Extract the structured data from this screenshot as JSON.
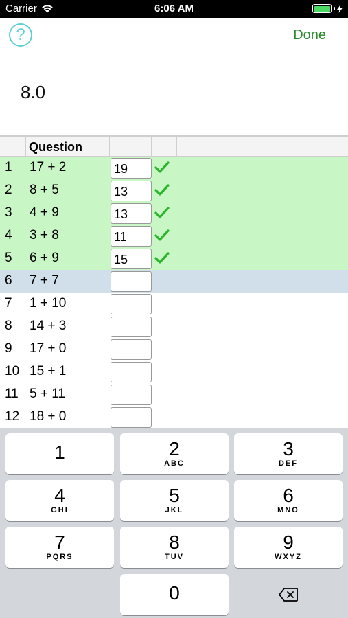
{
  "status_bar": {
    "carrier": "Carrier",
    "time": "6:06 AM"
  },
  "nav": {
    "help_icon": "question-circle-icon",
    "help_label": "?",
    "done_label": "Done"
  },
  "display": {
    "score": "8.0"
  },
  "table": {
    "headers": [
      "",
      "Question",
      "",
      "",
      "",
      ""
    ],
    "rows": [
      {
        "num": "1",
        "question": "17 + 2",
        "answer": "19",
        "status": "correct"
      },
      {
        "num": "2",
        "question": "8 + 5",
        "answer": "13",
        "status": "correct"
      },
      {
        "num": "3",
        "question": "4 + 9",
        "answer": "13",
        "status": "correct"
      },
      {
        "num": "4",
        "question": "3 + 8",
        "answer": "11",
        "status": "correct"
      },
      {
        "num": "5",
        "question": "6 + 9",
        "answer": "15",
        "status": "correct"
      },
      {
        "num": "6",
        "question": "7 + 7",
        "answer": "",
        "status": "current"
      },
      {
        "num": "7",
        "question": "1 + 10",
        "answer": "",
        "status": ""
      },
      {
        "num": "8",
        "question": "14 + 3",
        "answer": "",
        "status": ""
      },
      {
        "num": "9",
        "question": "17 + 0",
        "answer": "",
        "status": ""
      },
      {
        "num": "10",
        "question": "15 + 1",
        "answer": "",
        "status": ""
      },
      {
        "num": "11",
        "question": "5 + 11",
        "answer": "",
        "status": ""
      },
      {
        "num": "12",
        "question": "18 + 0",
        "answer": "",
        "status": ""
      }
    ]
  },
  "keyboard": {
    "keys": [
      {
        "digit": "1",
        "letters": ""
      },
      {
        "digit": "2",
        "letters": "ABC"
      },
      {
        "digit": "3",
        "letters": "DEF"
      },
      {
        "digit": "4",
        "letters": "GHI"
      },
      {
        "digit": "5",
        "letters": "JKL"
      },
      {
        "digit": "6",
        "letters": "MNO"
      },
      {
        "digit": "7",
        "letters": "PQRS"
      },
      {
        "digit": "8",
        "letters": "TUV"
      },
      {
        "digit": "9",
        "letters": "WXYZ"
      },
      {
        "digit": "0",
        "letters": ""
      }
    ],
    "delete_icon": "backspace-icon"
  },
  "colors": {
    "correct_row": "#c8f7c5",
    "current_row": "#d0dfea",
    "check": "#2bb52b",
    "done": "#2a8a2a",
    "help": "#5fd0d6"
  }
}
